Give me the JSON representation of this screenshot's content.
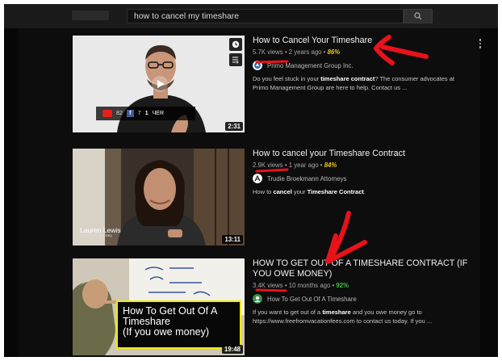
{
  "search": {
    "query": "how to cancel my timeshare"
  },
  "results": [
    {
      "title": "How to Cancel Your Timeshare",
      "views": "5.7K views",
      "age": "2 years ago",
      "percent": "86%",
      "channel": "Primo Management Group Inc.",
      "description_parts": [
        "Do you feel stuck in your ",
        "timeshare contract",
        "? The consumer advocates at Primo Management Group are here to help. Contact us ..."
      ],
      "duration": "2:31",
      "overlay": {
        "yt_count": "82",
        "fb_count": "7",
        "extra": "1 ",
        "extra_text": "ЧER"
      }
    },
    {
      "title": "How to cancel your Timeshare Contract",
      "views": "2.9K views",
      "age": "1 year ago",
      "percent": "84%",
      "channel": "Trudie Broekmann Attorneys",
      "description_parts": [
        "How to ",
        "cancel",
        " your ",
        "Timeshare Contract",
        "."
      ],
      "duration": "13:11",
      "overlay": {
        "name": "Lauren Lewis",
        "role": "Associate Attorney"
      }
    },
    {
      "title": "HOW TO GET OUT OF A TIMESHARE CONTRACT (IF YOU OWE MONEY)",
      "views": "3.4K views",
      "age": "10 months ago",
      "percent": "92%",
      "channel": "How To Get Out Of A Timeshare",
      "description_parts": [
        "If you want to get out of a ",
        "timeshare",
        " and you owe money go to https://www.freefromvacationfees.com to contact us today. If you ..."
      ],
      "duration": "19:48",
      "overlay": {
        "box_text": "How To Get Out Of A Timeshare",
        "box_sub": "(If you owe money)"
      }
    }
  ],
  "colors": {
    "background": "#0d0d0d",
    "annotation_red": "#e8121b",
    "percent_high": "#f0c419",
    "percent_top": "#3fbf4b"
  },
  "icons": [
    "search-icon",
    "watch-later-icon",
    "add-to-queue-icon",
    "more-vert-icon",
    "play-icon"
  ]
}
